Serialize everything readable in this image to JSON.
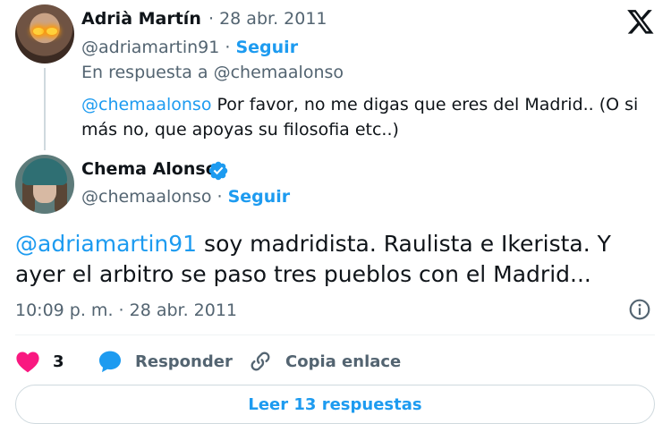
{
  "parent": {
    "name": "Adrià Martín",
    "date": "· 28 abr. 2011",
    "handle": "@adriamartin91",
    "separator": " · ",
    "follow": "Seguir",
    "reply_to": "En respuesta a @chemaalonso",
    "mention": "@chemaalonso",
    "text": " Por favor, no me digas que eres del Madrid.. (O si más no, que apoyas su filosofia etc..)"
  },
  "main": {
    "name": "Chema Alonso",
    "handle": "@chemaalonso",
    "separator": " · ",
    "follow": "Seguir",
    "mention": "@adriamartin91",
    "text": " soy madridista. Raulista e Ikerista. Y ayer el arbitro se paso tres pueblos con el Madrid...",
    "timestamp": "10:09 p. m. · 28 abr. 2011"
  },
  "actions": {
    "likes": "3",
    "reply": "Responder",
    "copy_link": "Copia enlace"
  },
  "read_replies": "Leer 13 respuestas",
  "icons": {
    "brand": "x-logo-icon",
    "verified": "verified-badge-icon",
    "info": "info-icon",
    "like": "heart-icon",
    "reply": "speech-bubble-icon",
    "link": "link-icon"
  },
  "colors": {
    "accent": "#1d9bf0",
    "like": "#f91880",
    "text": "#0f1419",
    "muted": "#536471"
  }
}
